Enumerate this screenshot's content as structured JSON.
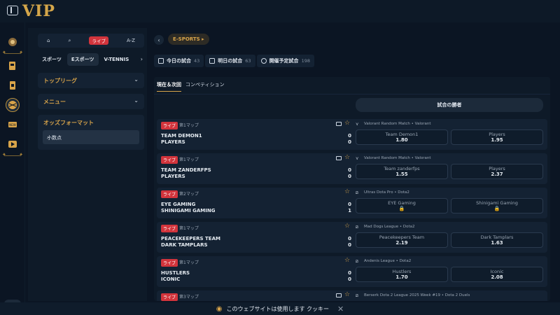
{
  "header": {
    "logo": "VIP"
  },
  "rail": {
    "chat_icon": "chat-icon"
  },
  "sidebar": {
    "quick": {
      "live": "ライブ",
      "az": "A-Z"
    },
    "tabs": [
      "スポーツ",
      "Eスポーツ",
      "V-TENNIS"
    ],
    "top_leagues": "トップリーグ",
    "menu": "メニュー",
    "odds_format": "オッズフォーマット",
    "odds_value": "小数点"
  },
  "breadcrumb": {
    "chip": "E-SPORTS ▸"
  },
  "filters": [
    {
      "label": "今日の試合",
      "count": "43"
    },
    {
      "label": "明日の試合",
      "count": "63"
    },
    {
      "label": "開催予定試合",
      "count": "198"
    }
  ],
  "content": {
    "tabs": [
      "現在＆次回",
      "コンペティション"
    ],
    "winner": "試合の勝者"
  },
  "matches": [
    {
      "live": "ライブ",
      "map": "第1マップ",
      "team1": "TEAM DEMON1",
      "team2": "PLAYERS",
      "score1": "0",
      "score2": "0",
      "league": "Valorant Random Match • Valorant",
      "odd1_name": "Team Demon1",
      "odd1_val": "1.80",
      "odd2_name": "Players",
      "odd2_val": "1.95"
    },
    {
      "live": "ライブ",
      "map": "第1マップ",
      "team1": "TEAM ZANDERFPS",
      "team2": "PLAYERS",
      "score1": "0",
      "score2": "0",
      "league": "Valorant Random Match • Valorant",
      "odd1_name": "Team zanderfps",
      "odd1_val": "1.55",
      "odd2_name": "Players",
      "odd2_val": "2.37"
    },
    {
      "live": "ライブ",
      "map": "第2マップ",
      "team1": "EYE GAMING",
      "team2": "SHINIGAMI GAMING",
      "score1": "0",
      "score2": "1",
      "league": "Ultras Dota Pro • Dota2",
      "odd1_name": "EYE Gaming",
      "odd1_val": "🔒",
      "odd2_name": "Shinigami Gaming",
      "odd2_val": "🔒"
    },
    {
      "live": "ライブ",
      "map": "第1マップ",
      "team1": "PEACEKEEPERS TEAM",
      "team2": "DARK TAMPLARS",
      "score1": "0",
      "score2": "0",
      "league": "Mad Dogs League • Dota2",
      "odd1_name": "Peacekeepers Team",
      "odd1_val": "2.19",
      "odd2_name": "Dark Tamplars",
      "odd2_val": "1.63"
    },
    {
      "live": "ライブ",
      "map": "第1マップ",
      "team1": "HUSTLERS",
      "team2": "ICONIC",
      "score1": "0",
      "score2": "0",
      "league": "Andenis League • Dota2",
      "odd1_name": "Hustlers",
      "odd1_val": "1.70",
      "odd2_name": "Iconic",
      "odd2_val": "2.08"
    },
    {
      "live": "ライブ",
      "map": "第3マップ",
      "team1": "",
      "team2": "",
      "score1": "",
      "score2": "",
      "league": "Berserk Dota 2 League 2025 Week #19 • Dota 2 Duels",
      "odd1_name": "",
      "odd1_val": "",
      "odd2_name": "",
      "odd2_val": ""
    }
  ],
  "cookie": {
    "text": "このウェブサイトは使用します クッキー",
    "close": "✕"
  },
  "colors": {
    "accent": "#d8a44a",
    "live": "#d2343c",
    "panel": "#142233",
    "bg": "#0b1523"
  }
}
